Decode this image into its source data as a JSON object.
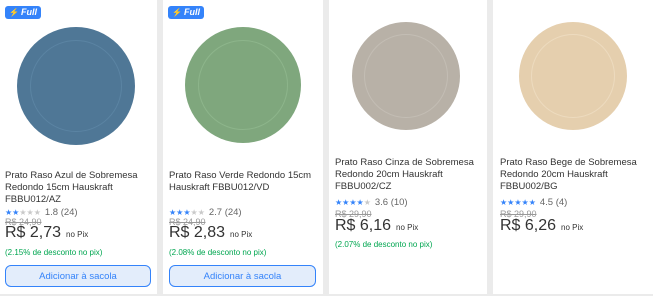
{
  "products": [
    {
      "badge": "Full",
      "title_lines": [
        "Prato Raso Azul de Sobremesa",
        "Redondo 15cm Hauskraft",
        "FBBU012/AZ"
      ],
      "stars": "★★",
      "stars_empty": "★★★",
      "rating": "1.8 (24)",
      "old_price": "R$ 24,90",
      "price": "R$ 2,73",
      "pix": "no Pix",
      "discount": "(2.15% de desconto no pix)",
      "button": "Adicionar à sacola",
      "plate_color": "#4f7796"
    },
    {
      "badge": "Full",
      "title_lines": [
        "Prato Raso Verde Redondo 15cm",
        "Hauskraft FBBU012/VD"
      ],
      "stars": "★★★",
      "stars_empty": "★★",
      "rating": "2.7 (24)",
      "old_price": "R$ 24,90",
      "price": "R$ 2,83",
      "pix": "no Pix",
      "discount": "(2.08% de desconto no pix)",
      "button": "Adicionar à sacola",
      "plate_color": "#7fa77d"
    },
    {
      "title_lines": [
        "Prato Raso Cinza de Sobremesa",
        "Redondo 20cm Hauskraft",
        "FBBU002/CZ"
      ],
      "stars": "★★★★",
      "stars_empty": "★",
      "rating": "3.6 (10)",
      "old_price": "R$ 29,90",
      "price": "R$ 6,16",
      "pix": "no Pix",
      "discount": "(2.07% de desconto no pix)",
      "plate_color": "#b8b1a7"
    },
    {
      "title_lines": [
        "Prato Raso Bege de Sobremesa",
        "Redondo 20cm Hauskraft",
        "FBBU002/BG"
      ],
      "stars": "★★★★★",
      "stars_empty": "",
      "rating": "4.5 (4)",
      "old_price": "R$ 29,90",
      "price": "R$ 6,26",
      "pix": "no Pix",
      "plate_color": "#e5cfae"
    }
  ]
}
